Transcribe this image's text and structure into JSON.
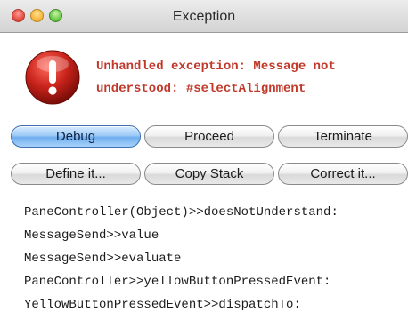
{
  "window": {
    "title": "Exception"
  },
  "alert": {
    "icon": "exclamation-icon",
    "message_line1": "Unhandled exception: Message not",
    "message_line2": "understood: #selectAlignment",
    "message_color": "#c0392b"
  },
  "buttons_row1": {
    "debug": "Debug",
    "proceed": "Proceed",
    "terminate": "Terminate"
  },
  "buttons_row2": {
    "define": "Define it...",
    "copy_stack": "Copy Stack",
    "correct": "Correct it..."
  },
  "stack_trace": [
    "PaneController(Object)>>doesNotUnderstand:",
    "MessageSend>>value",
    "MessageSend>>evaluate",
    "PaneController>>yellowButtonPressedEvent:",
    "YellowButtonPressedEvent>>dispatchTo:"
  ],
  "colors": {
    "default_button": "#6eaeee",
    "alert_red": "#c0392b"
  }
}
